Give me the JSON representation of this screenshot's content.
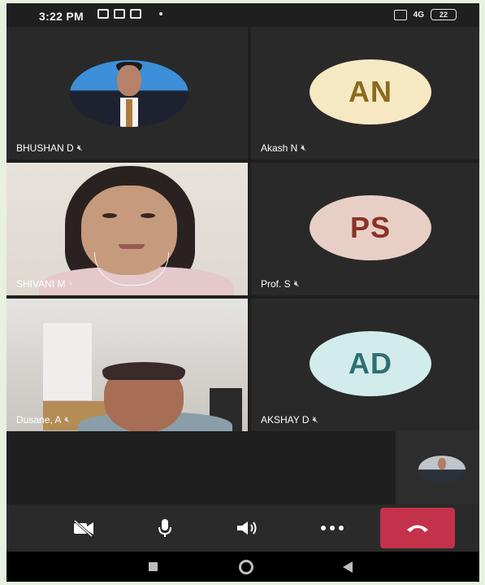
{
  "status_bar": {
    "time": "3:22 PM",
    "battery": "22",
    "network": "4G"
  },
  "participants": [
    {
      "name": "BHUSHAN D",
      "avatar_type": "photo",
      "muted": true
    },
    {
      "name": "Akash N",
      "initials": "AN",
      "avatar_color": "#f7e8c4",
      "text_color": "#8a6a1e",
      "muted": true
    },
    {
      "name": "SHIVANI M",
      "avatar_type": "video",
      "muted": true
    },
    {
      "name": "Prof. S",
      "initials": "PS",
      "avatar_color": "#e8cfc6",
      "text_color": "#8a3328",
      "muted": true
    },
    {
      "name": "Dusane, A",
      "avatar_type": "video",
      "muted": true
    },
    {
      "name": "AKSHAY D",
      "initials": "AD",
      "avatar_color": "#d2ecec",
      "text_color": "#2f6f74",
      "muted": true
    }
  ],
  "controls": {
    "camera": "camera-off-icon",
    "mic": "microphone-icon",
    "speaker": "speaker-icon",
    "more": "more-icon",
    "end_call": "end-call-icon"
  },
  "colors": {
    "end_call": "#c4314b",
    "tile_bg": "#292929"
  }
}
